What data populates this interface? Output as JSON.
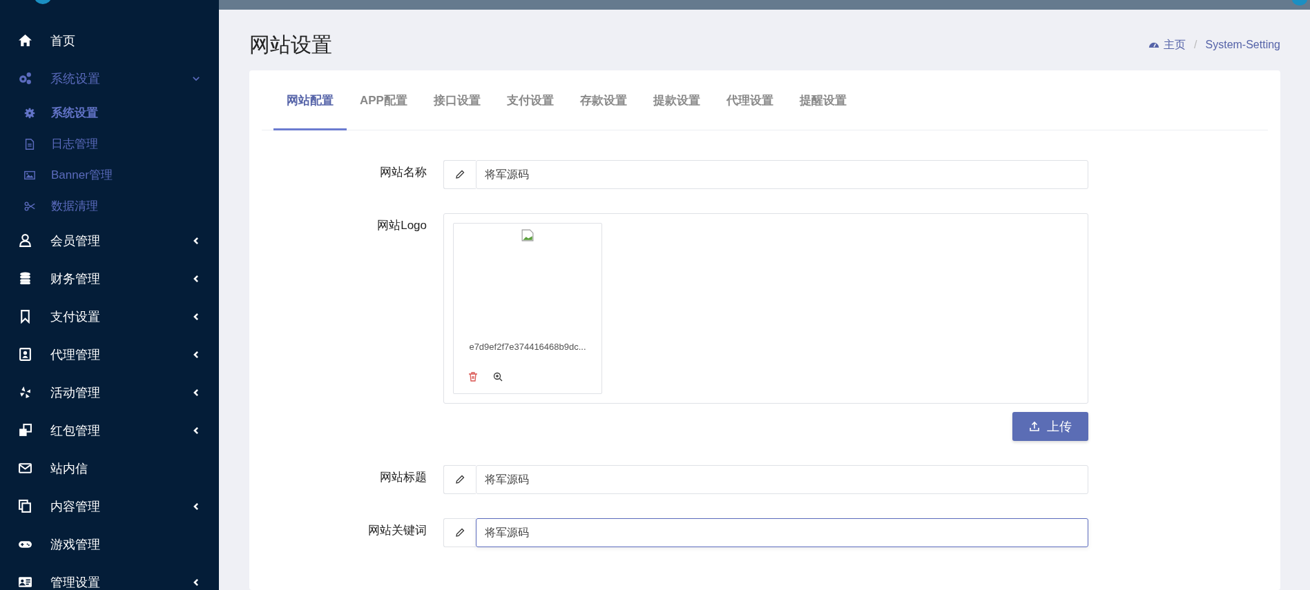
{
  "sidebar": {
    "items": [
      {
        "label": "首页"
      },
      {
        "label": "系统设置",
        "expanded": true,
        "children": [
          {
            "label": "系统设置",
            "selected": true
          },
          {
            "label": "日志管理",
            "selected": false
          },
          {
            "label": "Banner管理",
            "selected": false
          },
          {
            "label": "数据清理",
            "selected": false
          }
        ]
      },
      {
        "label": "会员管理",
        "expanded": false
      },
      {
        "label": "财务管理",
        "expanded": false
      },
      {
        "label": "支付设置",
        "expanded": false
      },
      {
        "label": "代理管理",
        "expanded": false
      },
      {
        "label": "活动管理",
        "expanded": false
      },
      {
        "label": "红包管理",
        "expanded": false
      },
      {
        "label": "站内信"
      },
      {
        "label": "内容管理",
        "expanded": false
      },
      {
        "label": "游戏管理"
      },
      {
        "label": "管理设置",
        "expanded": false
      }
    ]
  },
  "page": {
    "title": "网站设置",
    "breadcrumb": [
      "主页",
      "System-Setting"
    ],
    "breadcrumb_separator": "/"
  },
  "tabs": [
    {
      "label": "网站配置",
      "selected": true
    },
    {
      "label": "APP配置",
      "selected": false
    },
    {
      "label": "接口设置",
      "selected": false
    },
    {
      "label": "支付设置",
      "selected": false
    },
    {
      "label": "存款设置",
      "selected": false
    },
    {
      "label": "提款设置",
      "selected": false
    },
    {
      "label": "代理设置",
      "selected": false
    },
    {
      "label": "提醒设置",
      "selected": false
    }
  ],
  "form": [
    {
      "kind": "text",
      "label": "网站名称",
      "value": "将军源码",
      "focused": false
    },
    {
      "kind": "image",
      "label": "网站Logo",
      "file_name": "e7d9ef2f7e374416468b9dc...",
      "button": "上传"
    },
    {
      "kind": "text",
      "label": "网站标题",
      "value": "将军源码",
      "focused": false
    },
    {
      "kind": "text",
      "label": "网站关键词",
      "value": "将军源码",
      "focused": true
    }
  ]
}
